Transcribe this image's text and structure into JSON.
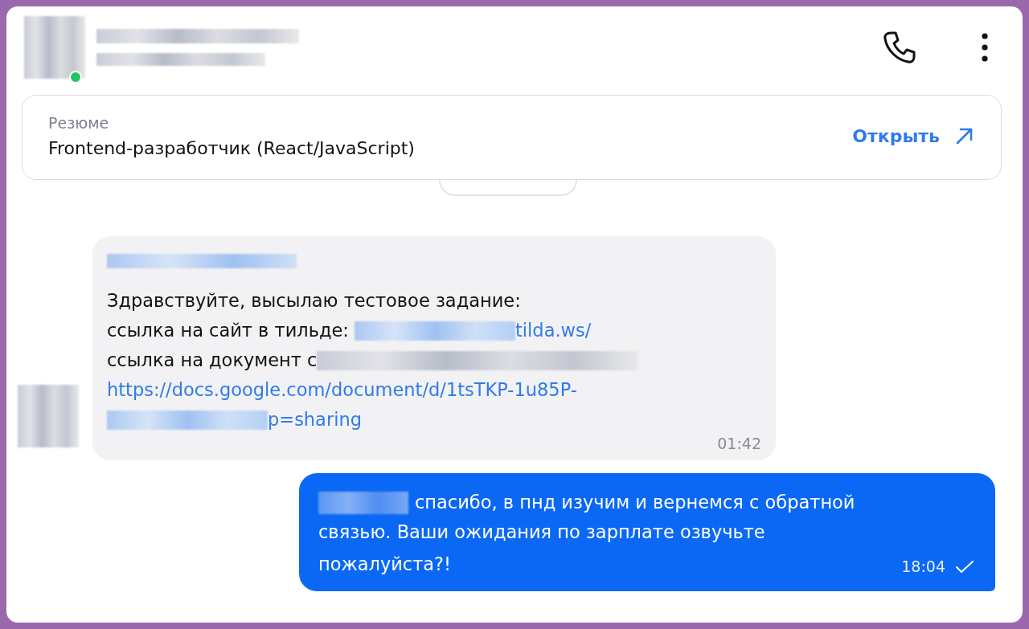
{
  "header": {
    "online": true
  },
  "resume_card": {
    "label": "Резюме",
    "title": "Frontend-разработчик (React/JavaScript)",
    "action": "Открыть"
  },
  "incoming": {
    "time": "01:42",
    "lines": [
      [
        {
          "kind": "text",
          "text": "Здравствуйте, высылаю тестовое задание:"
        }
      ],
      [
        {
          "kind": "text",
          "text": "ссылка на сайт в тильде: "
        },
        {
          "kind": "redacted_link"
        },
        {
          "kind": "link",
          "text": "tilda.ws/"
        }
      ],
      [
        {
          "kind": "text",
          "text": "ссылка на документ с"
        },
        {
          "kind": "redacted_text"
        }
      ],
      [
        {
          "kind": "link",
          "text": "https://docs.google.com/document/d/1tsTKP-1u85P-"
        }
      ],
      [
        {
          "kind": "redacted_link"
        },
        {
          "kind": "link",
          "text": "p=sharing"
        }
      ]
    ]
  },
  "outgoing": {
    "lines": [
      "спасибо, в пнд изучим и вернемся с обратной",
      "связью. Ваши ожидания по зарплате озвучьте",
      "пожалуйста?!"
    ],
    "time": "18:04",
    "read": true
  }
}
